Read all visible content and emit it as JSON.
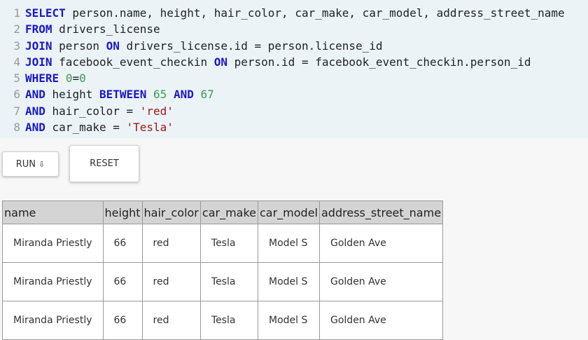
{
  "editor": {
    "lines": [
      [
        {
          "t": "kw",
          "v": "SELECT"
        },
        {
          "t": "code",
          "v": " person.name, height, hair_color, car_make, car_model, address_street_name"
        }
      ],
      [
        {
          "t": "kw",
          "v": "FROM"
        },
        {
          "t": "code",
          "v": " drivers_license"
        }
      ],
      [
        {
          "t": "kw",
          "v": "JOIN"
        },
        {
          "t": "code",
          "v": " person "
        },
        {
          "t": "kw",
          "v": "ON"
        },
        {
          "t": "code",
          "v": " drivers_license.id = person.license_id"
        }
      ],
      [
        {
          "t": "kw",
          "v": "JOIN"
        },
        {
          "t": "code",
          "v": " facebook_event_checkin "
        },
        {
          "t": "kw",
          "v": "ON"
        },
        {
          "t": "code",
          "v": " person.id = facebook_event_checkin.person_id"
        }
      ],
      [
        {
          "t": "kw",
          "v": "WHERE"
        },
        {
          "t": "code",
          "v": " "
        },
        {
          "t": "num",
          "v": "0"
        },
        {
          "t": "code",
          "v": "="
        },
        {
          "t": "num",
          "v": "0"
        }
      ],
      [
        {
          "t": "kw",
          "v": "AND"
        },
        {
          "t": "code",
          "v": " height "
        },
        {
          "t": "kw",
          "v": "BETWEEN"
        },
        {
          "t": "code",
          "v": " "
        },
        {
          "t": "num",
          "v": "65"
        },
        {
          "t": "code",
          "v": " "
        },
        {
          "t": "kw",
          "v": "AND"
        },
        {
          "t": "code",
          "v": " "
        },
        {
          "t": "num",
          "v": "67"
        }
      ],
      [
        {
          "t": "kw",
          "v": "AND"
        },
        {
          "t": "code",
          "v": " hair_color = "
        },
        {
          "t": "str",
          "v": "'red'"
        }
      ],
      [
        {
          "t": "kw",
          "v": "AND"
        },
        {
          "t": "code",
          "v": " car_make = "
        },
        {
          "t": "str",
          "v": "'Tesla'"
        }
      ]
    ]
  },
  "buttons": {
    "run_label": "RUN",
    "run_icon": "⇩",
    "reset_label": "RESET"
  },
  "table": {
    "columns": [
      "name",
      "height",
      "hair_color",
      "car_make",
      "car_model",
      "address_street_name"
    ],
    "rows": [
      [
        "Miranda Priestly",
        "66",
        "red",
        "Tesla",
        "Model S",
        "Golden Ave"
      ],
      [
        "Miranda Priestly",
        "66",
        "red",
        "Tesla",
        "Model S",
        "Golden Ave"
      ],
      [
        "Miranda Priestly",
        "66",
        "red",
        "Tesla",
        "Model S",
        "Golden Ave"
      ]
    ]
  }
}
